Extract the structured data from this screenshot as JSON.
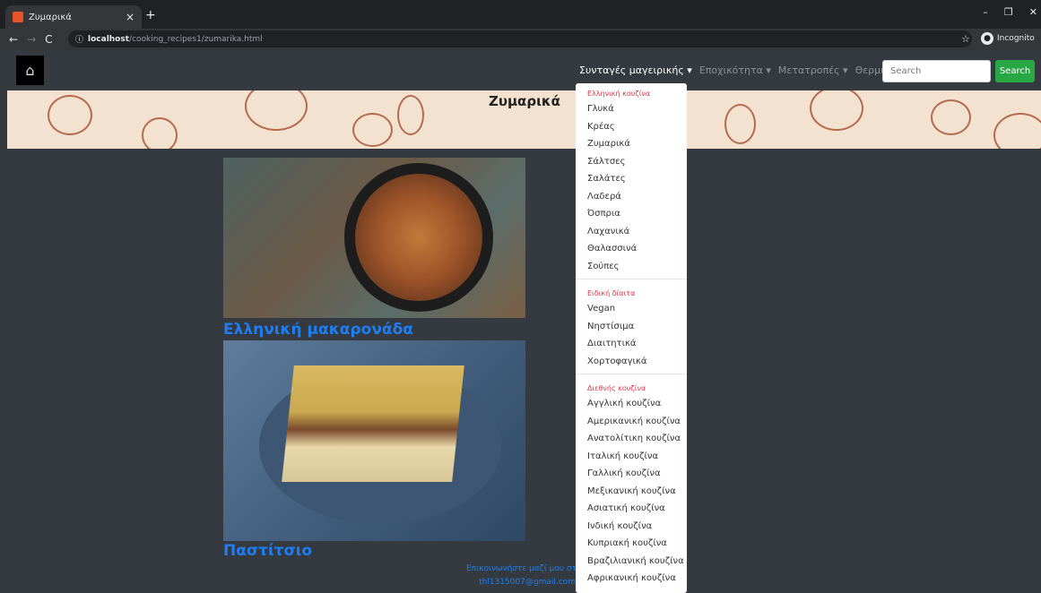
{
  "browser": {
    "tab_title": "Ζυμαρικά",
    "tab_close": "×",
    "new_tab": "+",
    "address_host": "localhost",
    "address_path": "/cooking_recipes1/zumarika.html",
    "incognito_label": "Incognito",
    "window_controls": [
      "–",
      "❐",
      "✕"
    ]
  },
  "navbar": {
    "links": [
      {
        "label": "Συνταγές μαγειρικής ▾",
        "active": true
      },
      {
        "label": "Εποχικότητα ▾",
        "active": false
      },
      {
        "label": "Μετατροπές ▾",
        "active": false
      },
      {
        "label": "Θερμιδομετρητής",
        "active": false
      }
    ],
    "search_placeholder": "Search",
    "search_button": "Search"
  },
  "banner": {
    "title": "Ζυμαρικά"
  },
  "recipes": [
    {
      "title": "Ελληνική μακαρονάδα"
    },
    {
      "title": "Παστίτσιο"
    }
  ],
  "footer": {
    "line1": "Επικοινωνήστε μαζί μου στ",
    "line2": "thl1315007@gmail.com"
  },
  "dropdown": {
    "sections": [
      {
        "header": "Ελληνική κουζίνα",
        "items": [
          "Γλυκά",
          "Κρέας",
          "Ζυμαρικά",
          "Σάλτσες",
          "Σαλάτες",
          "Λαδερά",
          "Όσπρια",
          "Λαχανικά",
          "Θαλασσινά",
          "Σούπες"
        ]
      },
      {
        "header": "Ειδική δίαιτα",
        "items": [
          "Vegan",
          "Νηστίσιμα",
          "Διαιτητικά",
          "Χορτοφαγικά"
        ]
      },
      {
        "header": "Διεθνής κουζίνα",
        "items": [
          "Αγγλική κουζίνα",
          "Αμερικανική κουζίνα",
          "Ανατολίτικη κουζίνα",
          "Ιταλική κουζίνα",
          "Γαλλική κουζίνα",
          "Μεξικανική κουζίνα",
          "Ασιατική κουζίνα",
          "Ινδική κουζίνα",
          "Κυπριακή κουζίνα",
          "Βραζιλιανική κουζίνα",
          "Αφρικανική κουζίνα"
        ]
      }
    ]
  },
  "colors": {
    "accent_link": "#1e7ef0",
    "search_button": "#28a745",
    "dropdown_header": "#dc3545"
  }
}
